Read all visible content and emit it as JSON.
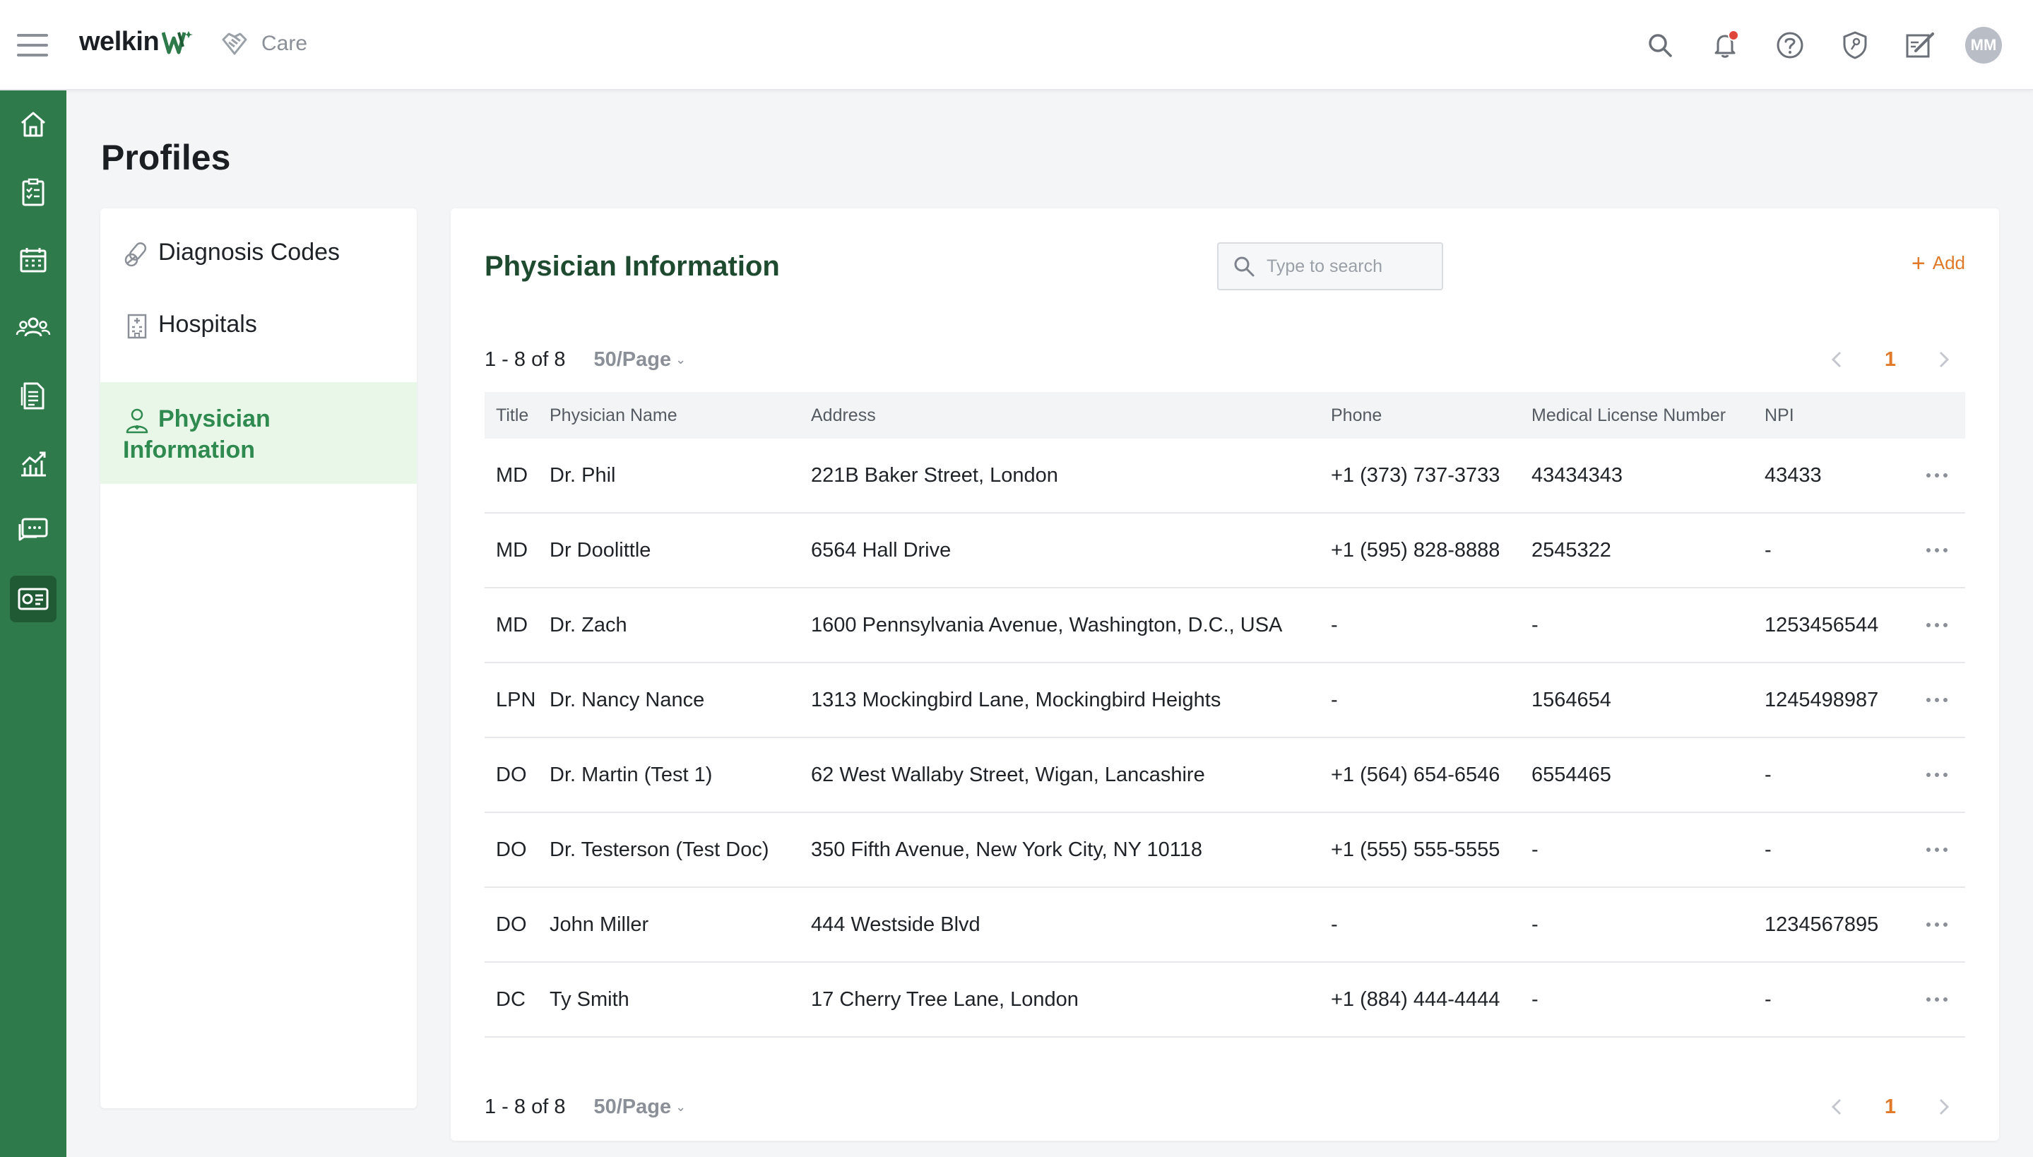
{
  "brand": {
    "name": "welkin",
    "app_label": "Care"
  },
  "header": {
    "avatar_initials": "MM"
  },
  "page": {
    "title": "Profiles"
  },
  "nav": {
    "items": [
      {
        "label": "Diagnosis Codes"
      },
      {
        "label": "Hospitals"
      },
      {
        "label": "Physician Information",
        "line1": "Physician",
        "line2": "Information"
      }
    ]
  },
  "card": {
    "title": "Physician Information",
    "search_placeholder": "Type to search",
    "add_label": "Add"
  },
  "pager": {
    "count": "1 - 8 of 8",
    "size": "50/Page",
    "current_page": "1"
  },
  "table": {
    "columns": [
      "Title",
      "Physician Name",
      "Address",
      "Phone",
      "Medical License Number",
      "NPI"
    ],
    "rows": [
      {
        "title": "MD",
        "name": "Dr. Phil",
        "address": "221B Baker Street, London",
        "phone": "+1 (373) 737-3733",
        "license": "43434343",
        "npi": "43433"
      },
      {
        "title": "MD",
        "name": "Dr Doolittle",
        "address": "6564 Hall Drive",
        "phone": "+1 (595) 828-8888",
        "license": "2545322",
        "npi": "-"
      },
      {
        "title": "MD",
        "name": "Dr. Zach",
        "address": "1600 Pennsylvania Avenue, Washington, D.C., USA",
        "phone": "-",
        "license": "-",
        "npi": "1253456544"
      },
      {
        "title": "LPN",
        "name": "Dr. Nancy Nance",
        "address": "1313 Mockingbird Lane, Mockingbird Heights",
        "phone": "-",
        "license": "1564654",
        "npi": "1245498987"
      },
      {
        "title": "DO",
        "name": "Dr. Martin (Test 1)",
        "address": "62 West Wallaby Street, Wigan, Lancashire",
        "phone": "+1 (564) 654-6546",
        "license": "6554465",
        "npi": "-"
      },
      {
        "title": "DO",
        "name": "Dr. Testerson (Test Doc)",
        "address": "350 Fifth Avenue, New York City, NY 10118",
        "phone": "+1 (555) 555-5555",
        "license": "-",
        "npi": "-"
      },
      {
        "title": "DO",
        "name": "John Miller",
        "address": "444 Westside Blvd",
        "phone": "-",
        "license": "-",
        "npi": "1234567895"
      },
      {
        "title": "DC",
        "name": "Ty Smith",
        "address": "17 Cherry Tree Lane, London",
        "phone": "+1 (884) 444-4444",
        "license": "-",
        "npi": "-"
      }
    ]
  },
  "colors": {
    "brand_green": "#2f7a4a",
    "accent_orange": "#e07a2a",
    "active_nav_bg": "#e9f7e9"
  },
  "icons": {
    "rail": [
      "home-icon",
      "tasks-icon",
      "calendar-icon",
      "patients-icon",
      "documents-icon",
      "analytics-icon",
      "messages-icon",
      "profiles-icon"
    ],
    "header": [
      "search-icon",
      "bell-icon",
      "help-icon",
      "security-shield-icon",
      "edit-form-icon"
    ]
  }
}
